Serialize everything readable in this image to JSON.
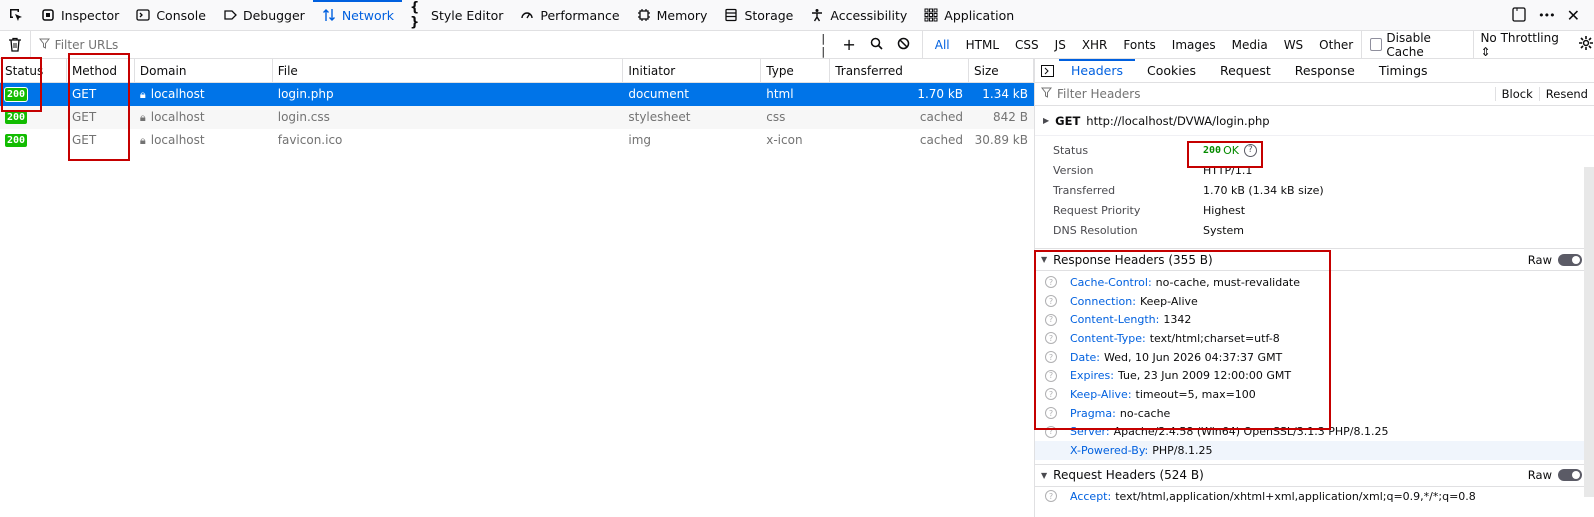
{
  "toolbar": {
    "tabs": [
      {
        "label": "Inspector",
        "icon": "inspector-icon"
      },
      {
        "label": "Console",
        "icon": "console-icon"
      },
      {
        "label": "Debugger",
        "icon": "debugger-icon"
      },
      {
        "label": "Network",
        "icon": "network-icon",
        "active": true
      },
      {
        "label": "Style Editor",
        "icon": "style-editor-icon"
      },
      {
        "label": "Performance",
        "icon": "performance-icon"
      },
      {
        "label": "Memory",
        "icon": "memory-icon"
      },
      {
        "label": "Storage",
        "icon": "storage-icon"
      },
      {
        "label": "Accessibility",
        "icon": "accessibility-icon"
      },
      {
        "label": "Application",
        "icon": "application-icon"
      }
    ],
    "more": "•••"
  },
  "filterbar": {
    "placeholder": "Filter URLs",
    "types": [
      "All",
      "HTML",
      "CSS",
      "JS",
      "XHR",
      "Fonts",
      "Images",
      "Media",
      "WS",
      "Other"
    ],
    "active_type": "All",
    "disable_cache": "Disable Cache",
    "throttling": "No Throttling ⇕"
  },
  "table": {
    "headers": {
      "status": "Status",
      "method": "Method",
      "domain": "Domain",
      "file": "File",
      "initiator": "Initiator",
      "type": "Type",
      "transferred": "Transferred",
      "size": "Size"
    },
    "rows": [
      {
        "status": "200",
        "method": "GET",
        "domain": "localhost",
        "file": "login.php",
        "initiator": "document",
        "type": "html",
        "transferred": "1.70 kB",
        "size": "1.34 kB"
      },
      {
        "status": "200",
        "method": "GET",
        "domain": "localhost",
        "file": "login.css",
        "initiator": "stylesheet",
        "type": "css",
        "transferred": "cached",
        "size": "842 B"
      },
      {
        "status": "200",
        "method": "GET",
        "domain": "localhost",
        "file": "favicon.ico",
        "initiator": "img",
        "type": "x-icon",
        "transferred": "cached",
        "size": "30.89 kB"
      }
    ]
  },
  "details": {
    "tabs": [
      "Headers",
      "Cookies",
      "Request",
      "Response",
      "Timings"
    ],
    "filter_placeholder": "Filter Headers",
    "block": "Block",
    "resend": "Resend",
    "request_method": "GET",
    "request_url": "http://localhost/DVWA/login.php",
    "summary": {
      "status_label": "Status",
      "status_code": "200",
      "status_text": "OK",
      "version_label": "Version",
      "version": "HTTP/1.1",
      "transferred_label": "Transferred",
      "transferred": "1.70 kB (1.34 kB size)",
      "priority_label": "Request Priority",
      "priority": "Highest",
      "dns_label": "DNS Resolution",
      "dns": "System"
    },
    "response_headers_title": "Response Headers (355 B)",
    "request_headers_title": "Request Headers (524 B)",
    "raw_label": "Raw",
    "response_headers": [
      {
        "name": "Cache-Control:",
        "value": "no-cache, must-revalidate"
      },
      {
        "name": "Connection:",
        "value": "Keep-Alive"
      },
      {
        "name": "Content-Length:",
        "value": "1342"
      },
      {
        "name": "Content-Type:",
        "value": "text/html;charset=utf-8"
      },
      {
        "name": "Date:",
        "value": "Wed, 10 Jun 2026 04:37:37 GMT"
      },
      {
        "name": "Expires:",
        "value": "Tue, 23 Jun 2009 12:00:00 GMT"
      },
      {
        "name": "Keep-Alive:",
        "value": "timeout=5, max=100"
      },
      {
        "name": "Pragma:",
        "value": "no-cache"
      },
      {
        "name": "Server:",
        "value": "Apache/2.4.58 (Win64) OpenSSL/3.1.3 PHP/8.1.25"
      },
      {
        "name": "X-Powered-By:",
        "value": "PHP/8.1.25"
      }
    ],
    "request_headers": [
      {
        "name": "Accept:",
        "value": "text/html,application/xhtml+xml,application/xml;q=0.9,*/*;q=0.8"
      }
    ]
  }
}
